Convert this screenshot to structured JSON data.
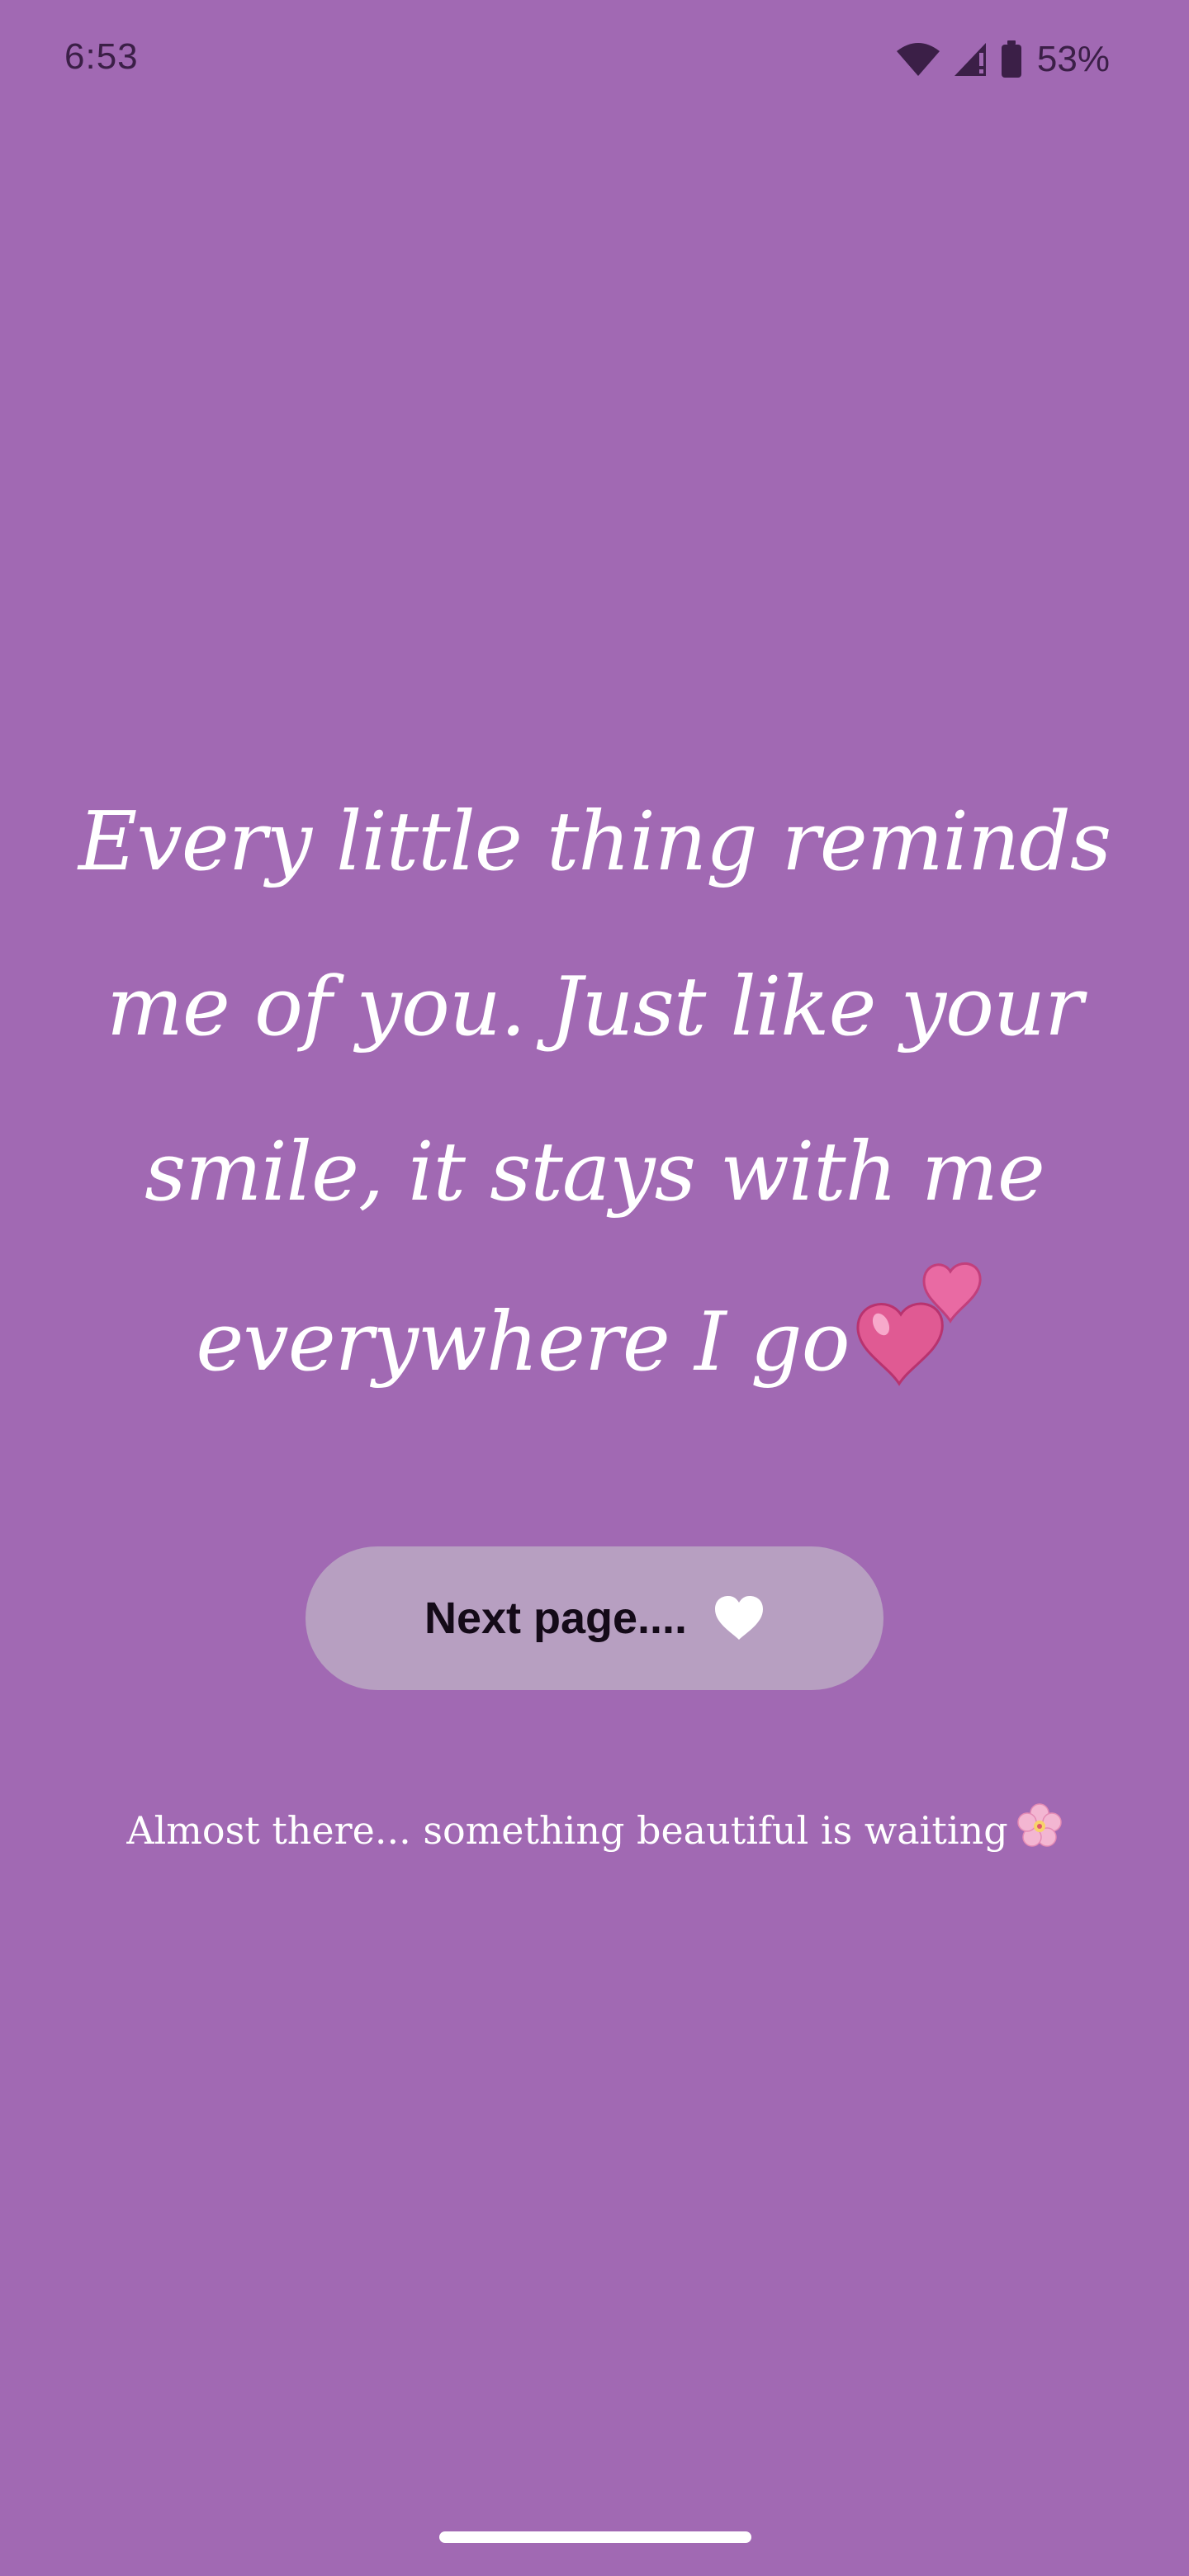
{
  "status_bar": {
    "time": "6:53",
    "battery_percent": "53%",
    "icons": [
      "wifi-icon",
      "signal-icon",
      "battery-icon"
    ]
  },
  "quote": {
    "text": "Every little thing reminds me of you. Just like your smile, it stays with me everywhere I go",
    "emoji_icon": "two-hearts-icon"
  },
  "next_button": {
    "label": "Next page....",
    "icon": "white-heart-icon"
  },
  "hint": {
    "text": "Almost there... something beautiful is waiting",
    "emoji_icon": "cherry-blossom-icon"
  },
  "colors": {
    "background": "#a169b3",
    "button": "#b79fc1",
    "text": "#ffffff",
    "heart_pink": "#e05a93"
  }
}
